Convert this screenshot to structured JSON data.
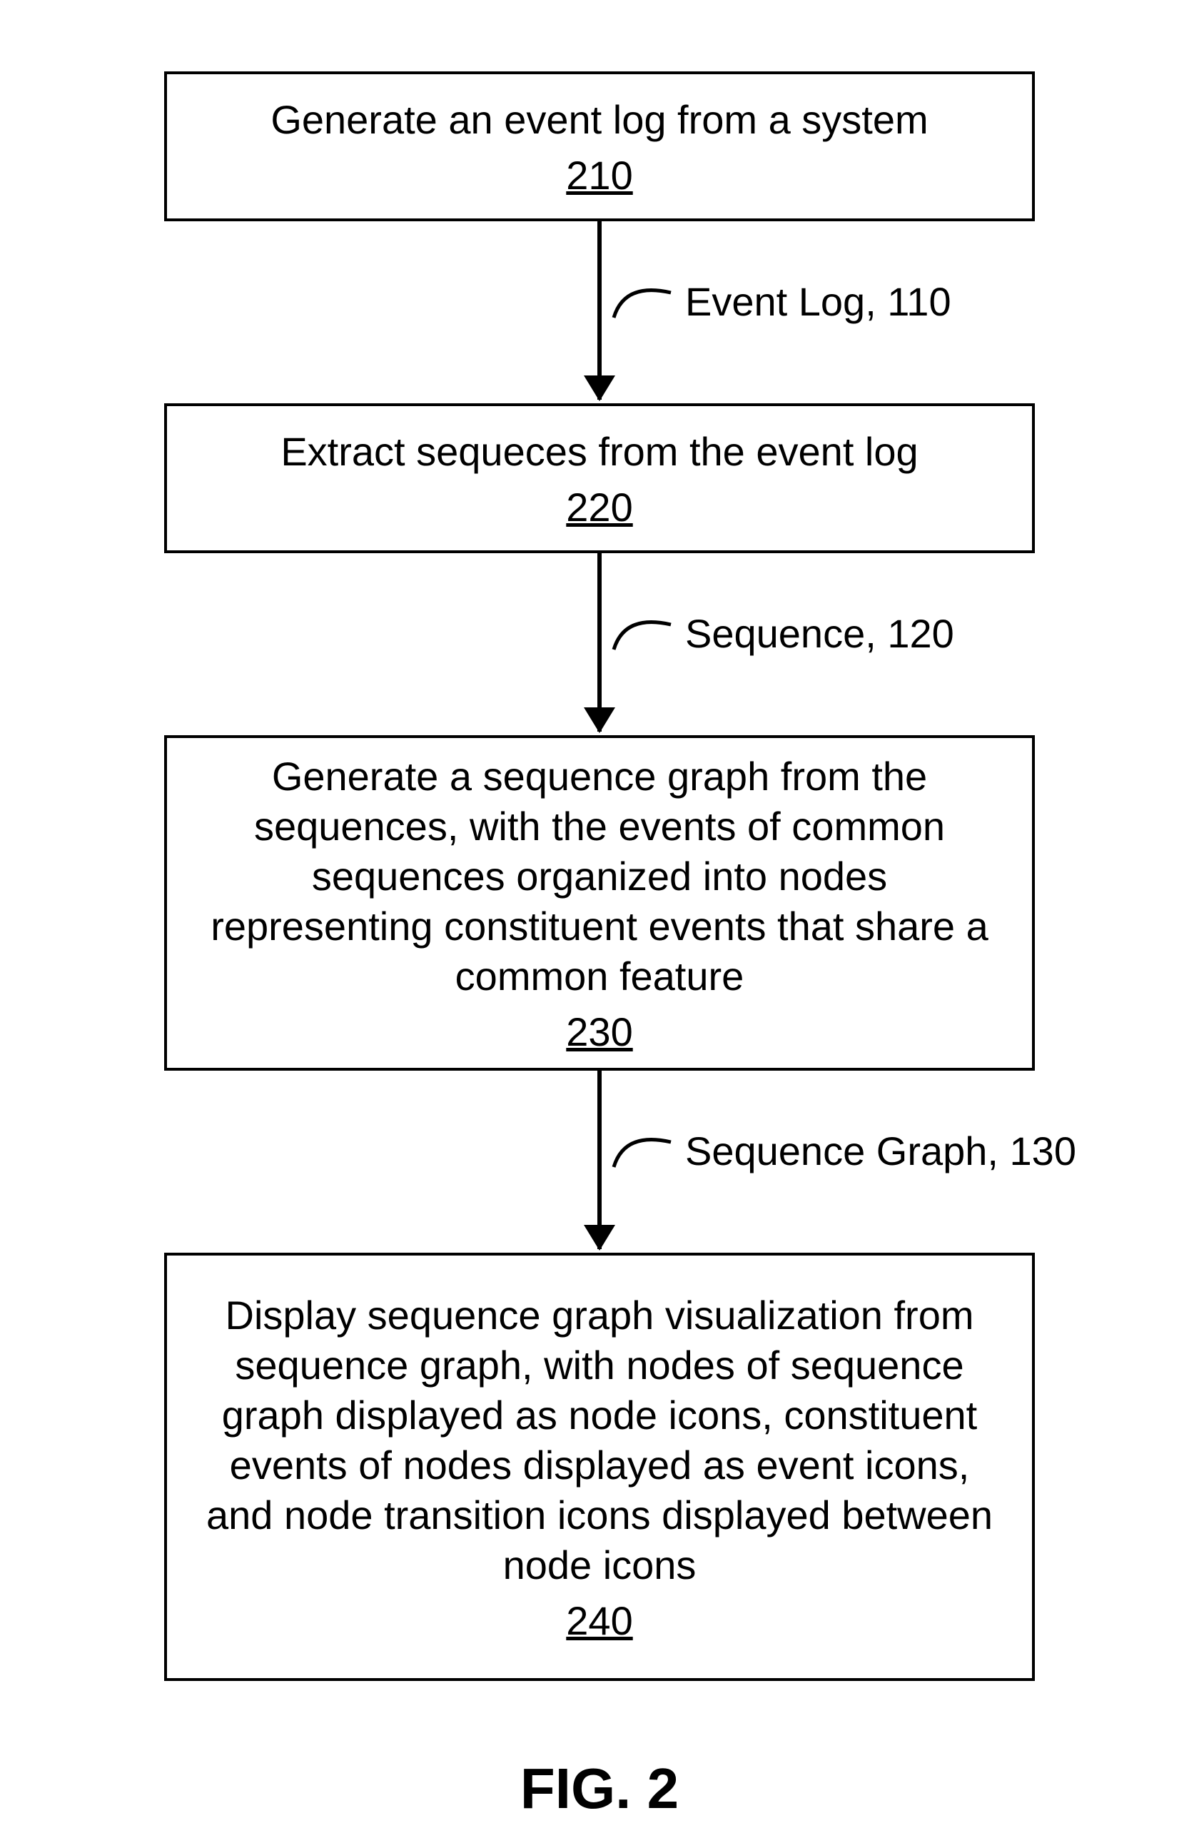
{
  "boxes": {
    "b1": {
      "text": "Generate an event log from a system",
      "ref": "210"
    },
    "b2": {
      "text": "Extract sequeces from the event log",
      "ref": "220"
    },
    "b3": {
      "text": "Generate a sequence graph from the sequences, with the events of common sequences organized into nodes representing constituent events that share a common feature",
      "ref": "230"
    },
    "b4": {
      "text": "Display sequence graph visualization from sequence graph, with nodes of sequence graph displayed as node icons, constituent events of nodes displayed as event icons, and node transition icons displayed between node icons",
      "ref": "240"
    }
  },
  "edges": {
    "e1": "Event Log, 110",
    "e2": "Sequence, 120",
    "e3": "Sequence Graph, 130"
  },
  "caption": "FIG. 2"
}
